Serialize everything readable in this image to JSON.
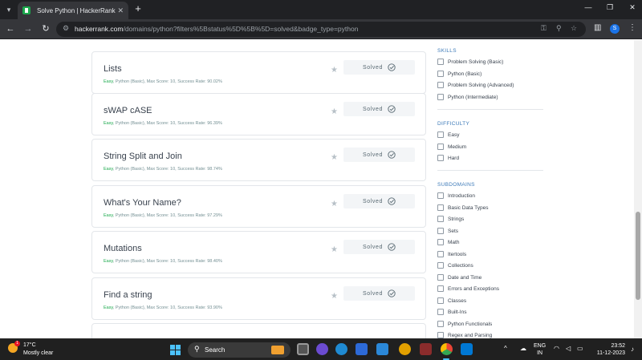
{
  "browser": {
    "tab_title": "Solve Python | HackerRank",
    "url_host": "hackerrank.com",
    "url_path": "/domains/python?filters%5Bstatus%5D%5B%5D=solved&badge_type=python",
    "profile_initial": "S"
  },
  "challenges": [
    {
      "title": "Lists",
      "difficulty": "Easy",
      "meta": ", Python (Basic), Max Score: 10, Success Rate: 90.02%",
      "status": "Solved"
    },
    {
      "title": "sWAP cASE",
      "difficulty": "Easy",
      "meta": ", Python (Basic), Max Score: 10, Success Rate: 96.39%",
      "status": "Solved"
    },
    {
      "title": "String Split and Join",
      "difficulty": "Easy",
      "meta": ", Python (Basic), Max Score: 10, Success Rate: 98.74%",
      "status": "Solved"
    },
    {
      "title": "What's Your Name?",
      "difficulty": "Easy",
      "meta": ", Python (Basic), Max Score: 10, Success Rate: 97.29%",
      "status": "Solved"
    },
    {
      "title": "Mutations",
      "difficulty": "Easy",
      "meta": ", Python (Basic), Max Score: 10, Success Rate: 98.40%",
      "status": "Solved"
    },
    {
      "title": "Find a string",
      "difficulty": "Easy",
      "meta": ", Python (Basic), Max Score: 10, Success Rate: 93.90%",
      "status": "Solved"
    }
  ],
  "filters": {
    "skills": {
      "heading": "SKILLS",
      "items": [
        "Problem Solving (Basic)",
        "Python (Basic)",
        "Problem Solving (Advanced)",
        "Python (Intermediate)"
      ]
    },
    "difficulty": {
      "heading": "DIFFICULTY",
      "items": [
        "Easy",
        "Medium",
        "Hard"
      ]
    },
    "subdomains": {
      "heading": "SUBDOMAINS",
      "items": [
        "Introduction",
        "Basic Data Types",
        "Strings",
        "Sets",
        "Math",
        "Itertools",
        "Collections",
        "Date and Time",
        "Errors and Exceptions",
        "Classes",
        "Built-Ins",
        "Python Functionals",
        "Regex and Parsing"
      ]
    }
  },
  "taskbar": {
    "weather_temp": "17°C",
    "weather_desc": "Mostly clear",
    "weather_badge": "1",
    "search_label": "Search",
    "lang_line1": "ENG",
    "lang_line2": "IN",
    "time": "23:52",
    "date": "11-12-2023"
  },
  "colors": {
    "accent_green": "#1ba94c",
    "link_blue": "#3d7ab8",
    "start_blue": "#4cc2ff"
  }
}
